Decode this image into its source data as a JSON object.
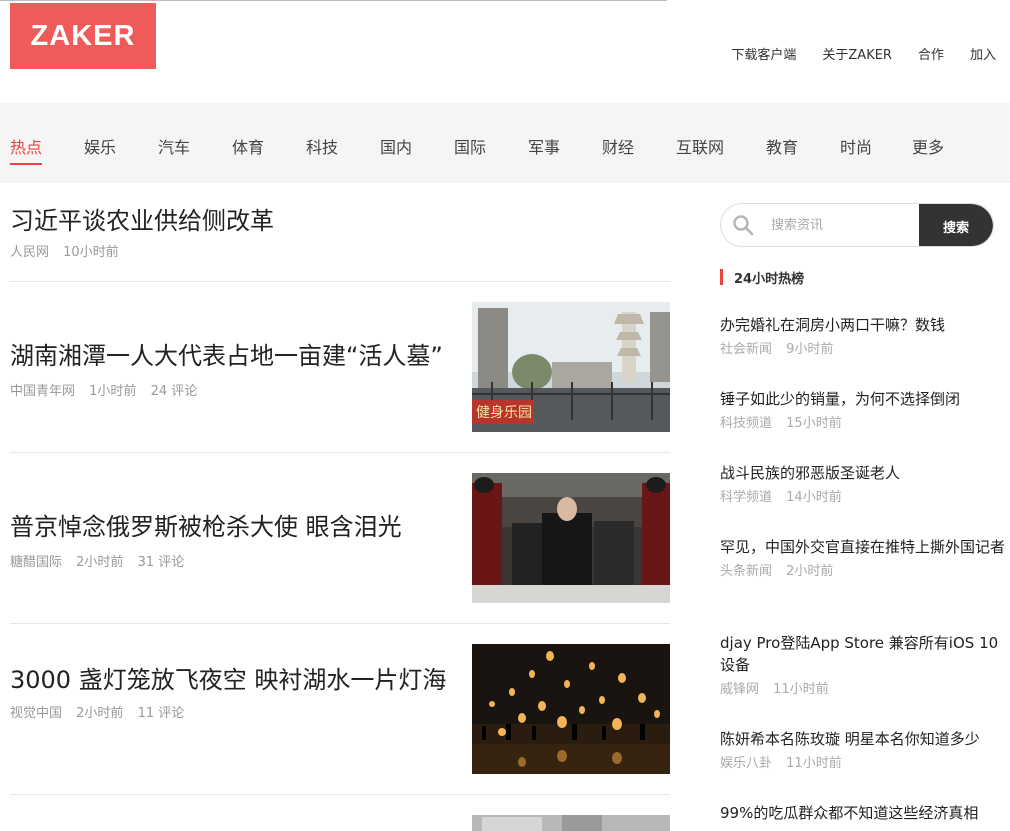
{
  "header": {
    "logo": "ZAKER",
    "top_nav": [
      "下载客户端",
      "关于ZAKER",
      "合作",
      "加入"
    ]
  },
  "channels": [
    "热点",
    "娱乐",
    "汽车",
    "体育",
    "科技",
    "国内",
    "国际",
    "军事",
    "财经",
    "互联网",
    "教育",
    "时尚",
    "更多"
  ],
  "active_channel": "热点",
  "articles": [
    {
      "title": "习近平谈农业供给侧改革",
      "source": "人民网",
      "time": "10小时前",
      "comments": ""
    },
    {
      "title": "湖南湘潭一人大代表占地一亩建“活人墓”",
      "source": "中国青年网",
      "time": "1小时前",
      "comments": "24 评论",
      "image_text": "健身乐园"
    },
    {
      "title": "普京悼念俄罗斯被枪杀大使 眼含泪光",
      "source": "糖醋国际",
      "time": "2小时前",
      "comments": "31 评论"
    },
    {
      "title": "3000 盏灯笼放飞夜空 映衬湖水一片灯海",
      "source": "视觉中国",
      "time": "2小时前",
      "comments": "11 评论"
    }
  ],
  "search": {
    "placeholder": "搜索资讯",
    "button": "搜索",
    "icon": "search-icon"
  },
  "hot": {
    "title": "24小时热榜",
    "items": [
      {
        "title": "办完婚礼在洞房小两口干嘛？数钱",
        "source": "社会新闻",
        "time": "9小时前"
      },
      {
        "title": "锤子如此少的销量，为何不选择倒闭",
        "source": "科技频道",
        "time": "15小时前"
      },
      {
        "title": "战斗民族的邪恶版圣诞老人",
        "source": "科学频道",
        "time": "14小时前"
      },
      {
        "title": "罕见，中国外交官直接在推特上撕外国记者",
        "source": "头条新闻",
        "time": "2小时前"
      },
      {
        "title": "djay Pro登陆App Store 兼容所有iOS 10设备",
        "source": "威锋网",
        "time": "11小时前"
      },
      {
        "title": "陈妍希本名陈玫璇 明星本名你知道多少",
        "source": "娱乐八卦",
        "time": "11小时前"
      },
      {
        "title": "99%的吃瓜群众都不知道这些经济真相",
        "source": "",
        "time": ""
      }
    ]
  },
  "colors": {
    "accent": "#e8453c",
    "logo_bg": "#f15a5b",
    "search_btn": "#333333"
  }
}
